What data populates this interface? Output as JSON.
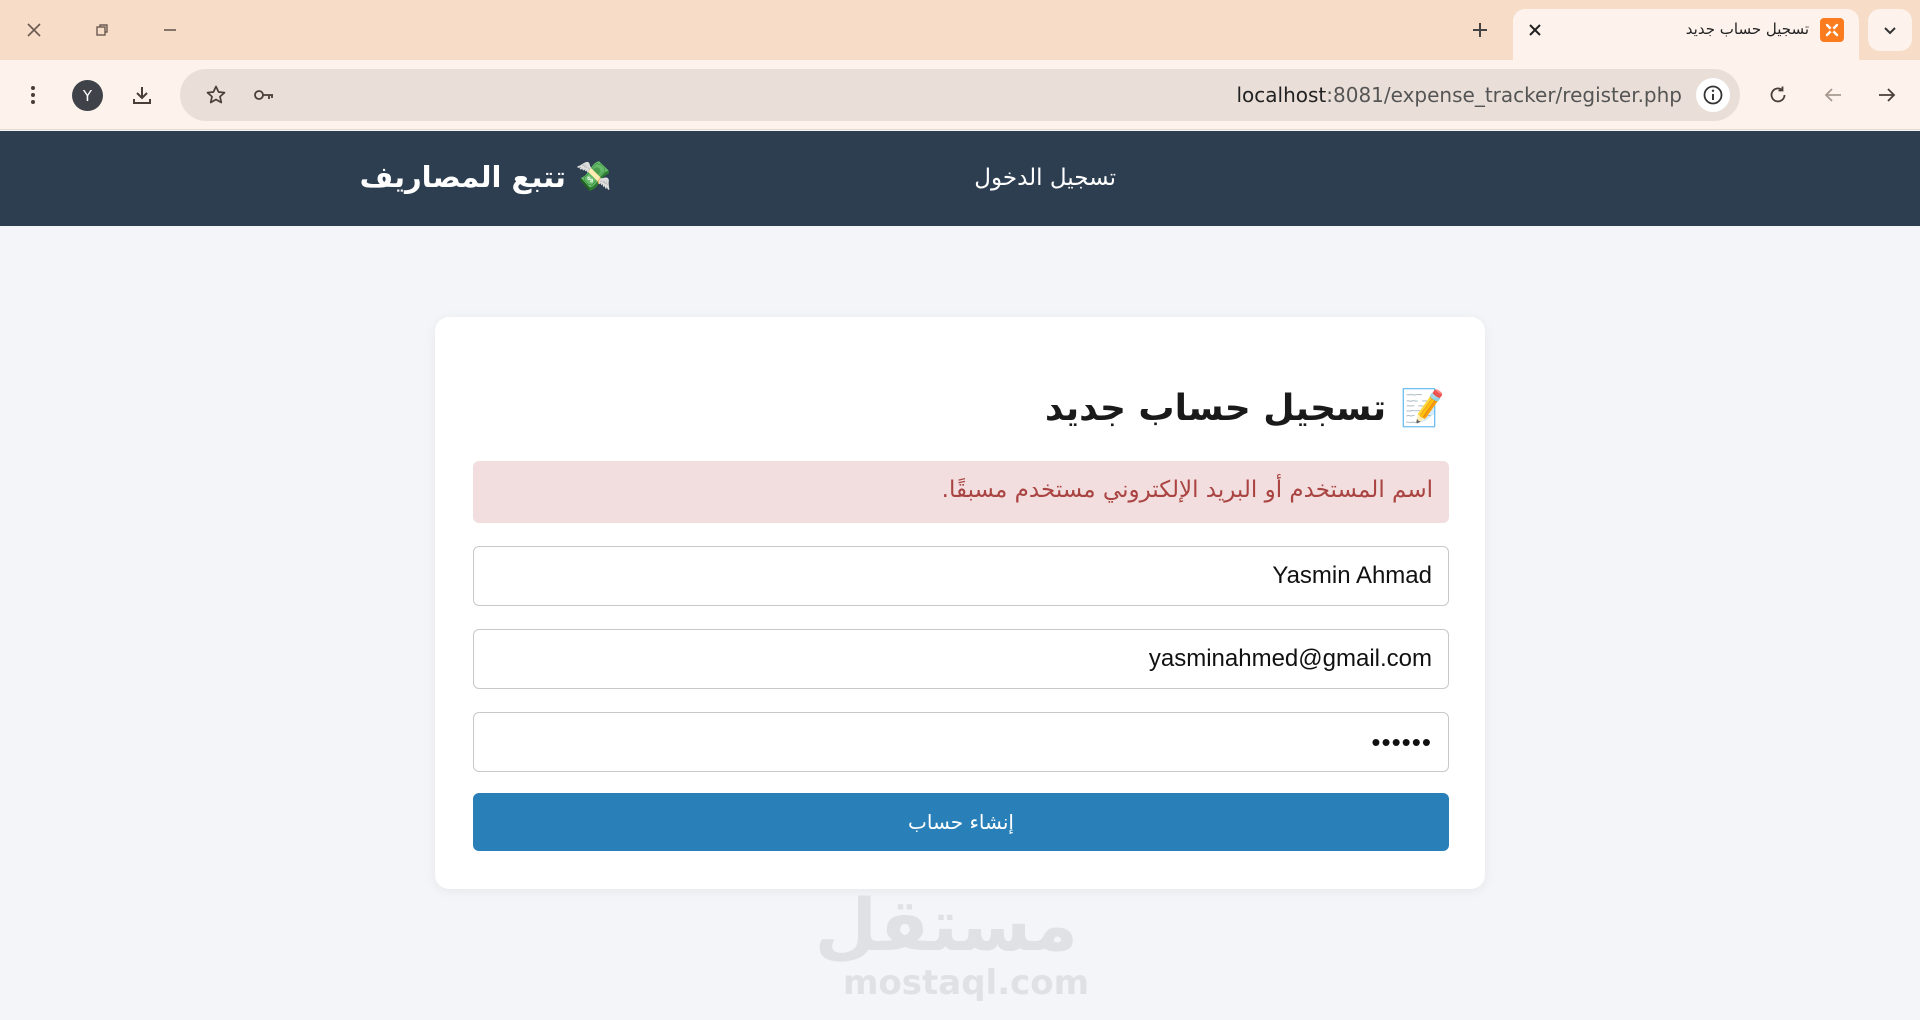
{
  "browser": {
    "tab": {
      "title": "تسجيل حساب جديد",
      "favicon": "xampp-icon"
    },
    "url_host": "localhost",
    "url_rest": ":8081/expense_tracker/register.php",
    "profile_initial": "Y"
  },
  "header": {
    "brand_icon": "💸",
    "brand_title": "تتبع المصاريف",
    "nav_login": "تسجيل الدخول"
  },
  "form": {
    "title_icon": "📝",
    "title": "تسجيل حساب جديد",
    "error": "اسم المستخدم أو البريد الإلكتروني مستخدم مسبقًا.",
    "username": "Yasmin Ahmad",
    "email": "yasminahmed@gmail.com",
    "password": "••••••",
    "submit": "إنشاء حساب"
  },
  "watermark": {
    "arabic": "مستقل",
    "latin": "mostaql.com"
  },
  "colors": {
    "header_bg": "#2c3e50",
    "button_bg": "#2980b9",
    "alert_bg": "#f2dede",
    "alert_text": "#a94442",
    "page_bg": "#f4f5f8"
  }
}
